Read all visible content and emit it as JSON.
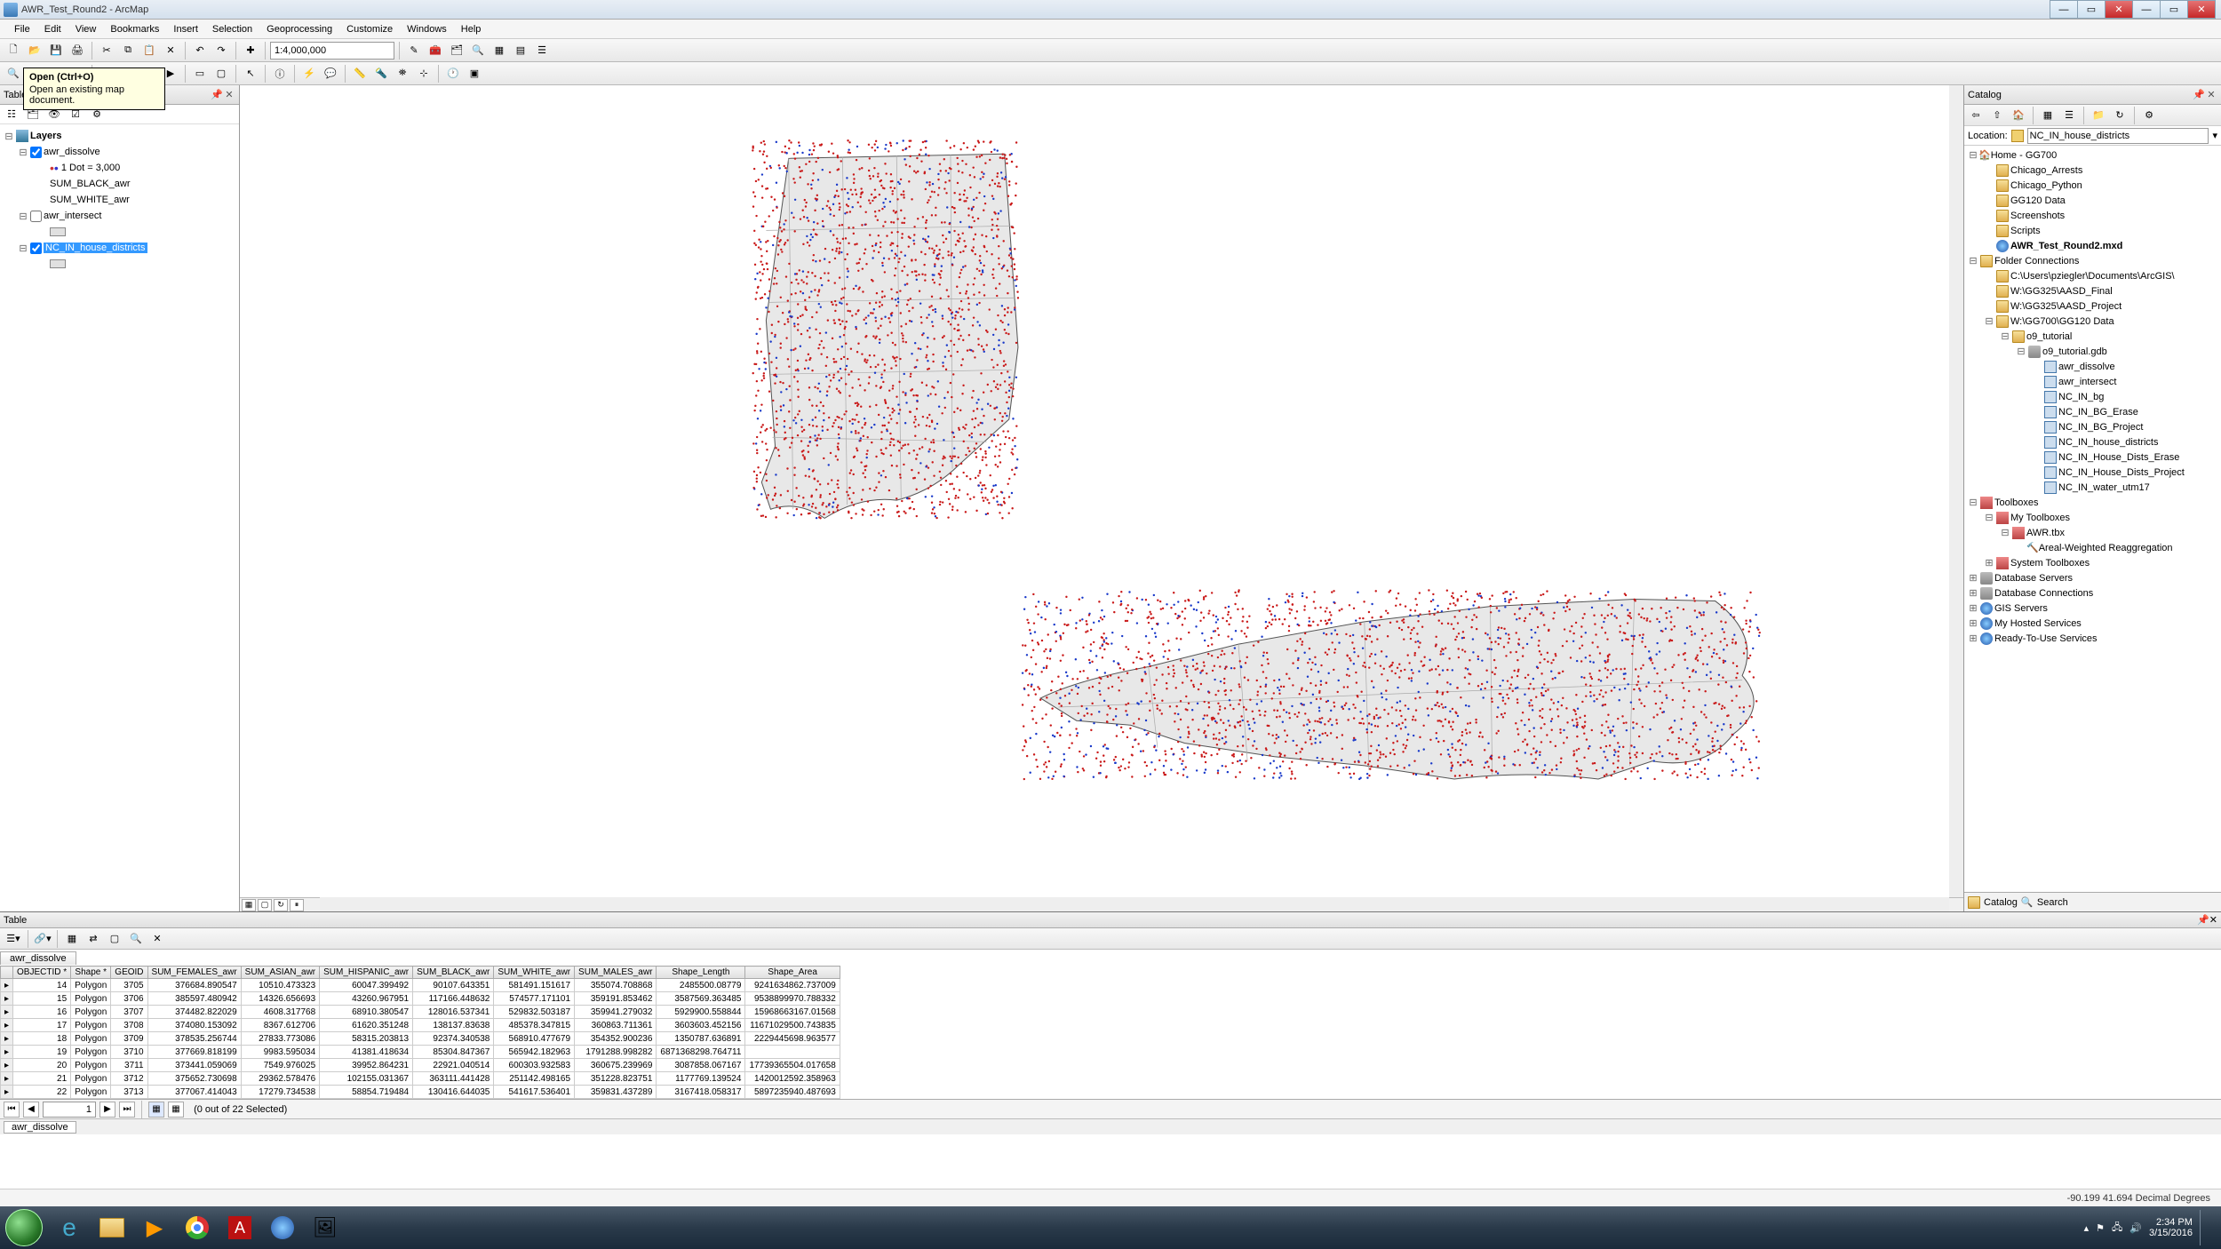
{
  "window": {
    "title": "AWR_Test_Round2 - ArcMap"
  },
  "menu": [
    "File",
    "Edit",
    "View",
    "Bookmarks",
    "Insert",
    "Selection",
    "Geoprocessing",
    "Customize",
    "Windows",
    "Help"
  ],
  "tooltip": {
    "title": "Open (Ctrl+O)",
    "body": "Open an existing map document."
  },
  "scale": "1:4,000,000",
  "toc": {
    "title": "Table Of Contents",
    "root": "Layers",
    "layers": [
      {
        "name": "awr_dissolve",
        "checked": true,
        "children": [
          {
            "label": "1 Dot = 3,000"
          },
          {
            "label": "SUM_BLACK_awr"
          },
          {
            "label": "SUM_WHITE_awr"
          }
        ]
      },
      {
        "name": "awr_intersect",
        "checked": false
      },
      {
        "name": "NC_IN_house_districts",
        "checked": true,
        "selected": true
      }
    ]
  },
  "catalog": {
    "title": "Catalog",
    "location_label": "Location:",
    "location": "NC_IN_house_districts",
    "tree": [
      {
        "l": 0,
        "t": "home",
        "n": "Home - GG700",
        "exp": "-"
      },
      {
        "l": 1,
        "t": "folder",
        "n": "Chicago_Arrests"
      },
      {
        "l": 1,
        "t": "folder",
        "n": "Chicago_Python"
      },
      {
        "l": 1,
        "t": "folder",
        "n": "GG120 Data"
      },
      {
        "l": 1,
        "t": "folder",
        "n": "Screenshots"
      },
      {
        "l": 1,
        "t": "folder",
        "n": "Scripts"
      },
      {
        "l": 1,
        "t": "mxd",
        "n": "AWR_Test_Round2.mxd",
        "bold": true
      },
      {
        "l": 0,
        "t": "fconn",
        "n": "Folder Connections",
        "exp": "-"
      },
      {
        "l": 1,
        "t": "folder",
        "n": "C:\\Users\\pziegler\\Documents\\ArcGIS\\"
      },
      {
        "l": 1,
        "t": "folder",
        "n": "W:\\GG325\\AASD_Final"
      },
      {
        "l": 1,
        "t": "folder",
        "n": "W:\\GG325\\AASD_Project"
      },
      {
        "l": 1,
        "t": "folder",
        "n": "W:\\GG700\\GG120 Data",
        "exp": "-"
      },
      {
        "l": 2,
        "t": "folder",
        "n": "o9_tutorial",
        "exp": "-"
      },
      {
        "l": 3,
        "t": "gdb",
        "n": "o9_tutorial.gdb",
        "exp": "-"
      },
      {
        "l": 4,
        "t": "fc",
        "n": "awr_dissolve"
      },
      {
        "l": 4,
        "t": "fc",
        "n": "awr_intersect"
      },
      {
        "l": 4,
        "t": "fc",
        "n": "NC_IN_bg"
      },
      {
        "l": 4,
        "t": "fc",
        "n": "NC_IN_BG_Erase"
      },
      {
        "l": 4,
        "t": "fc",
        "n": "NC_IN_BG_Project"
      },
      {
        "l": 4,
        "t": "fc",
        "n": "NC_IN_house_districts"
      },
      {
        "l": 4,
        "t": "fc",
        "n": "NC_IN_House_Dists_Erase"
      },
      {
        "l": 4,
        "t": "fc",
        "n": "NC_IN_House_Dists_Project"
      },
      {
        "l": 4,
        "t": "fc",
        "n": "NC_IN_water_utm17"
      },
      {
        "l": 0,
        "t": "toolbox",
        "n": "Toolboxes",
        "exp": "-"
      },
      {
        "l": 1,
        "t": "toolbox",
        "n": "My Toolboxes",
        "exp": "-"
      },
      {
        "l": 2,
        "t": "tbx",
        "n": "AWR.tbx",
        "exp": "-"
      },
      {
        "l": 3,
        "t": "tool",
        "n": "Areal-Weighted Reaggregation"
      },
      {
        "l": 1,
        "t": "toolbox",
        "n": "System Toolboxes",
        "exp": "+"
      },
      {
        "l": 0,
        "t": "db",
        "n": "Database Servers",
        "exp": "+"
      },
      {
        "l": 0,
        "t": "db",
        "n": "Database Connections",
        "exp": "+"
      },
      {
        "l": 0,
        "t": "srv",
        "n": "GIS Servers",
        "exp": "+"
      },
      {
        "l": 0,
        "t": "srv",
        "n": "My Hosted Services",
        "exp": "+"
      },
      {
        "l": 0,
        "t": "srv",
        "n": "Ready-To-Use Services",
        "exp": "+"
      }
    ],
    "bottom_tabs": [
      "Catalog",
      "Search"
    ]
  },
  "table": {
    "title": "Table",
    "tab": "awr_dissolve",
    "bottom_tab": "awr_dissolve",
    "columns": [
      "OBJECTID *",
      "Shape *",
      "GEOID",
      "SUM_FEMALES_awr",
      "SUM_ASIAN_awr",
      "SUM_HISPANIC_awr",
      "SUM_BLACK_awr",
      "SUM_WHITE_awr",
      "SUM_MALES_awr",
      "Shape_Length",
      "Shape_Area"
    ],
    "rows": [
      [
        14,
        "Polygon",
        3705,
        "376684.890547",
        "10510.473323",
        "60047.399492",
        "90107.643351",
        "581491.151617",
        "355074.708868",
        "2485500.08779",
        "9241634862.737009"
      ],
      [
        15,
        "Polygon",
        3706,
        "385597.480942",
        "14326.656693",
        "43260.967951",
        "117166.448632",
        "574577.171101",
        "359191.853462",
        "3587569.363485",
        "9538899970.788332"
      ],
      [
        16,
        "Polygon",
        3707,
        "374482.822029",
        "4608.317768",
        "68910.380547",
        "128016.537341",
        "529832.503187",
        "359941.279032",
        "5929900.558844",
        "15968663167.01568"
      ],
      [
        17,
        "Polygon",
        3708,
        "374080.153092",
        "8367.612706",
        "61620.351248",
        "138137.83638",
        "485378.347815",
        "360863.711361",
        "3603603.452156",
        "11671029500.743835"
      ],
      [
        18,
        "Polygon",
        3709,
        "378535.256744",
        "27833.773086",
        "58315.203813",
        "92374.340538",
        "568910.477679",
        "354352.900236",
        "1350787.636891",
        "2229445698.963577"
      ],
      [
        19,
        "Polygon",
        3710,
        "377669.818199",
        "9983.595034",
        "41381.418634",
        "85304.847367",
        "565942.182963",
        "1791288.998282",
        "6871368298.764711",
        ""
      ],
      [
        20,
        "Polygon",
        3711,
        "373441.059069",
        "7549.976025",
        "39952.864231",
        "22921.040514",
        "600303.932583",
        "360675.239969",
        "3087858.067167",
        "17739365504.017658"
      ],
      [
        21,
        "Polygon",
        3712,
        "375652.730698",
        "29362.578476",
        "102155.031367",
        "363111.441428",
        "251142.498165",
        "351228.823751",
        "1177769.139524",
        "1420012592.358963"
      ],
      [
        22,
        "Polygon",
        3713,
        "377067.414043",
        "17279.734538",
        "58854.719484",
        "130416.644035",
        "541617.536401",
        "359831.437289",
        "3167418.058317",
        "5897235940.487693"
      ]
    ],
    "nav": {
      "page": "1",
      "status": "(0 out of 22 Selected)"
    }
  },
  "status": {
    "coords": "-90.199 41.694 Decimal Degrees"
  },
  "tray": {
    "time": "2:34 PM",
    "date": "3/15/2016"
  }
}
